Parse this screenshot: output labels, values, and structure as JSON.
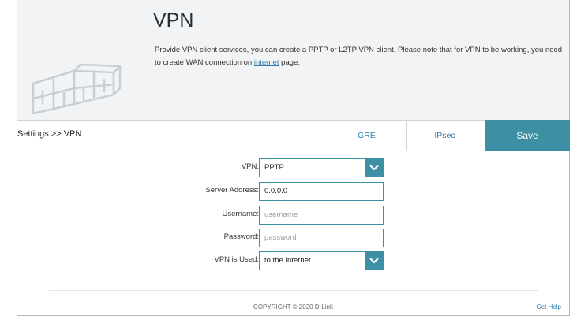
{
  "header": {
    "title": "VPN",
    "description_part1": "Provide VPN client services, you can create a PPTP or L2TP VPN client. Please note that for VPN to be working, you need to create WAN connection on ",
    "description_link": "internet",
    "description_part2": " page.",
    "illustration_icon": "brick-wall-icon"
  },
  "tabbar": {
    "breadcrumb": "Settings >> VPN",
    "tabs": [
      "GRE",
      "IPsec"
    ],
    "save_label": "Save"
  },
  "form": {
    "vpn": {
      "label": "VPN:",
      "value": "PPTP"
    },
    "server_address": {
      "label": "Server Address:",
      "value": "0.0.0.0"
    },
    "username": {
      "label": "Username:",
      "placeholder": "username"
    },
    "password": {
      "label": "Password:",
      "placeholder": "password"
    },
    "vpn_used": {
      "label": "VPN is Used:",
      "value": "to the Internet"
    }
  },
  "footer": {
    "copyright": "COPYRIGHT © 2020 D-Link",
    "help": "Get Help"
  },
  "colors": {
    "accent": "#3d8fa3",
    "link": "#2e7fb0",
    "banner_bg": "#f1f3f5"
  }
}
